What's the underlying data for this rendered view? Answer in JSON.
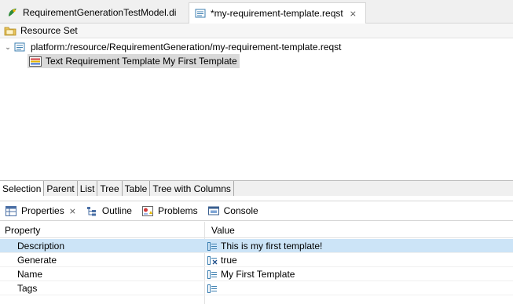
{
  "editor_tabs": [
    {
      "label": "RequirementGenerationTestModel.di",
      "icon": "papyrus-diagram-icon"
    },
    {
      "label": "*my-requirement-template.reqst",
      "icon": "reqst-file-icon",
      "close": "⨯"
    }
  ],
  "resource_set": {
    "label": "Resource Set",
    "icon": "resource-set-icon"
  },
  "tree": {
    "root": {
      "expander": "⌄",
      "label": "platform:/resource/RequirementGeneration/my-requirement-template.reqst"
    },
    "child": {
      "label": "Text Requirement Template My First Template"
    }
  },
  "view_tabs": [
    "Selection",
    "Parent",
    "List",
    "Tree",
    "Table",
    "Tree with Columns"
  ],
  "panel_tabs": [
    {
      "label": "Properties",
      "icon": "properties-icon",
      "close": "⨯"
    },
    {
      "label": "Outline",
      "icon": "outline-icon"
    },
    {
      "label": "Problems",
      "icon": "problems-icon"
    },
    {
      "label": "Console",
      "icon": "console-icon"
    }
  ],
  "properties": {
    "headers": {
      "property": "Property",
      "value": "Value"
    },
    "rows": [
      {
        "name": "Description",
        "value": "This is my first template!",
        "icon": "text-value-icon",
        "selected": true
      },
      {
        "name": "Generate",
        "value": "true",
        "icon": "boolean-value-icon"
      },
      {
        "name": "Name",
        "value": "My First Template",
        "icon": "text-value-icon"
      },
      {
        "name": "Tags",
        "value": "",
        "icon": "text-value-icon"
      }
    ]
  },
  "colors": {
    "selection_blue": "#cce4f7",
    "tree_selection": "#d9d9d9"
  }
}
